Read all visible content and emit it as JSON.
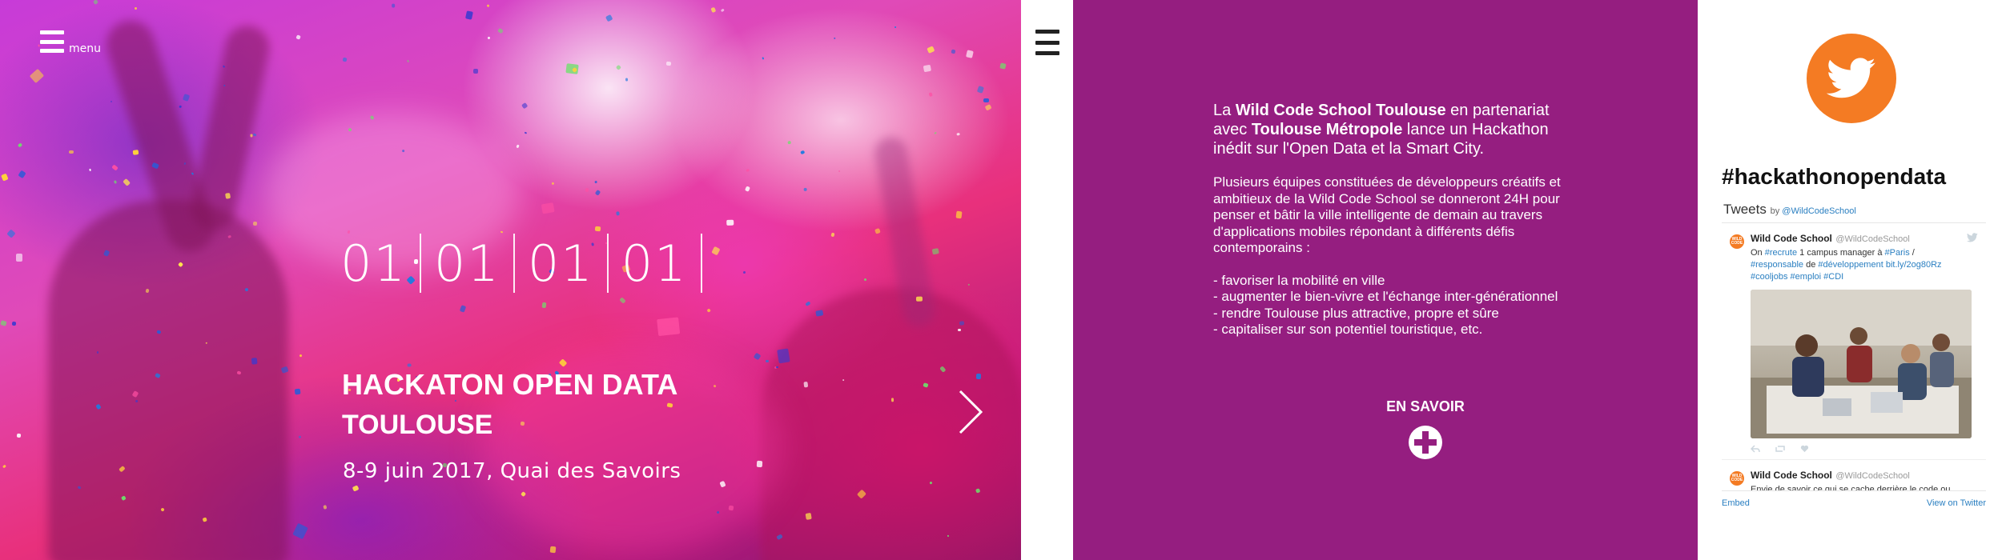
{
  "hero": {
    "menu_label": "menu",
    "countdown": [
      "01",
      "01",
      "01",
      "01"
    ],
    "title": "HACKATON OPEN DATA",
    "city": "TOULOUSE",
    "date": "8-9 juin 2017, Quai des Savoirs"
  },
  "info": {
    "intro": {
      "p1": "La ",
      "org": "Wild Code School Toulouse",
      "p2": " en partenariat avec ",
      "partner": "Toulouse Métropole",
      "p3": " lance un Hackathon inédit sur l'Open Data et la Smart City."
    },
    "paragraph": "Plusieurs équipes constituées de développeurs créatifs et ambitieux de  la Wild Code School se donneront 24H pour penser et bâtir la ville intelligente de demain au travers d'applications mobiles répondant à différents défis contemporains :",
    "goals": [
      "- favoriser la mobilité en ville",
      "- augmenter le bien-vivre et l'échange inter-générationnel",
      "- rendre Toulouse plus attractive, propre et sûre",
      "- capitaliser sur son potentiel touristique, etc."
    ],
    "cta_label": "EN SAVOIR"
  },
  "twitter": {
    "hashtag": "#hackathonopendata",
    "tweets_label": "Tweets",
    "by_label": "by",
    "by_handle": "@WildCodeSchool",
    "tweets": [
      {
        "author": "Wild Code School",
        "handle": "@WildCodeSchool",
        "text_parts": [
          "On ",
          "#recrute",
          " 1 campus manager à ",
          "#Paris",
          " / ",
          "#responsable",
          " de ",
          "#développement",
          " ",
          "bit.ly/2og80Rz",
          " ",
          "#cooljobs",
          " ",
          "#emploi",
          " ",
          "#CDI"
        ]
      },
      {
        "author": "Wild Code School",
        "handle": "@WildCodeSchool",
        "text": "Envie de savoir ce qui se cache derrière le code ou"
      }
    ],
    "avatar_text": "WILD CODE",
    "embed_label": "Embed",
    "view_label": "View on Twitter"
  },
  "colors": {
    "purple": "#951e80",
    "twitter_orange": "#f47b23",
    "link_blue": "#2a7fc1"
  },
  "icons": [
    "menu-icon",
    "chevron-right-icon",
    "plus-circle-icon",
    "twitter-bird-icon",
    "reply-icon",
    "retweet-icon",
    "like-icon"
  ]
}
